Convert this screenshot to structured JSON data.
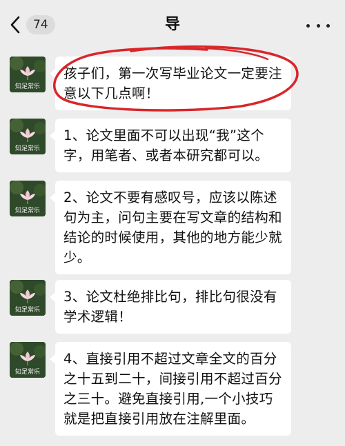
{
  "header": {
    "back_badge": "74",
    "title": "导"
  },
  "avatar_caption": "知足常乐",
  "colors": {
    "background": "#ededed",
    "bubble": "#ffffff",
    "highlight_circle": "#d8262b"
  },
  "messages": [
    {
      "text": "孩子们，第一次写毕业论文一定要注意以下几点啊！"
    },
    {
      "text": "1、论文里面不可以出现“我”这个字，用笔者、或者本研究都可以。"
    },
    {
      "text": "2、论文不要有感叹号，应该以陈述句为主，问句主要在写文章的结构和结论的时候使用，其他的地方能少就少。"
    },
    {
      "text": "3、论文杜绝排比句，排比句很没有学术逻辑！"
    },
    {
      "text": "4、直接引用不超过文章全文的百分之十五到二十，间接引用不超过百分之三十。避免直接引用,一个小技巧就是把直接引用放在注解里面。"
    }
  ]
}
